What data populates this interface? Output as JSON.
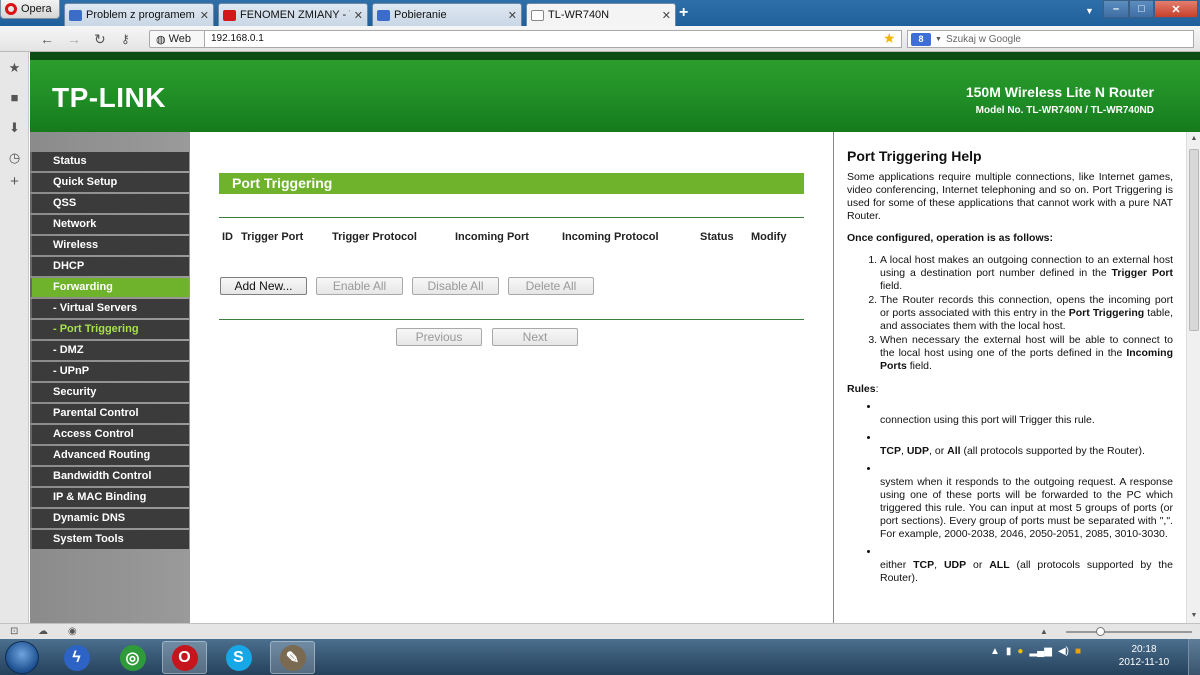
{
  "browser": {
    "menu_label": "Opera",
    "tabs": [
      {
        "title": "Problem z programem ...",
        "fav_color": "#3b6cc7"
      },
      {
        "title": "FENOMEN ZMIANY - Y...",
        "fav_color": "#d21818"
      },
      {
        "title": "Pobieranie",
        "fav_color": "#3b6cc7"
      },
      {
        "title": "TL-WR740N",
        "fav_color": "#888888"
      }
    ],
    "web_label": "Web",
    "url": "192.168.0.1",
    "search_placeholder": "Szukaj w Google",
    "window_min": "–",
    "window_max": "□",
    "window_close": "✕"
  },
  "router": {
    "brand": "TP-LINK",
    "product": "150M Wireless Lite N Router",
    "model": "Model No. TL-WR740N / TL-WR740ND",
    "accent_color": "#6fb22b",
    "menu": [
      {
        "label": "Status"
      },
      {
        "label": "Quick Setup"
      },
      {
        "label": "QSS"
      },
      {
        "label": "Network"
      },
      {
        "label": "Wireless"
      },
      {
        "label": "DHCP"
      },
      {
        "label": "Forwarding"
      },
      {
        "label": "- Virtual Servers"
      },
      {
        "label": "- Port Triggering"
      },
      {
        "label": "- DMZ"
      },
      {
        "label": "- UPnP"
      },
      {
        "label": "Security"
      },
      {
        "label": "Parental Control"
      },
      {
        "label": "Access Control"
      },
      {
        "label": "Advanced Routing"
      },
      {
        "label": "Bandwidth Control"
      },
      {
        "label": "IP & MAC Binding"
      },
      {
        "label": "Dynamic DNS"
      },
      {
        "label": "System Tools"
      }
    ],
    "section_title": "Port Triggering",
    "columns": [
      "ID",
      "Trigger Port",
      "Trigger Protocol",
      "Incoming Port",
      "Incoming Protocol",
      "Status",
      "Modify"
    ],
    "buttons": {
      "add_new": "Add New...",
      "enable_all": "Enable All",
      "disable_all": "Disable All",
      "delete_all": "Delete All",
      "previous": "Previous",
      "next": "Next"
    }
  },
  "help": {
    "title": "Port Triggering Help",
    "intro": "Some applications require multiple connections, like Internet games, video conferencing, Internet telephoning and so on. Port Triggering is used for some of these applications that cannot work with a pure NAT Router.",
    "configured_heading": "Once configured, operation is as follows:",
    "step1_a": "A local host makes an outgoing connection to an external host using a destination port number defined in the ",
    "step1_b": "Trigger Port",
    "step1_c": " field.",
    "step2_a": "The Router records this connection, opens the incoming port or ports associated with this entry in the ",
    "step2_b": "Port Triggering",
    "step2_c": " table, and associates them with the local host.",
    "step3_a": "When necessary the external host will be able to connect to the local host using one of the ports defined in the ",
    "step3_b": "Incoming Ports",
    "step3_c": " field.",
    "rules_heading": "Rules",
    "rules_colon": ":",
    "rule1": "connection using this port will Trigger this rule.",
    "rule2_a": "TCP",
    "rule2_b": ", ",
    "rule2_c": "UDP",
    "rule2_d": ", or ",
    "rule2_e": "All",
    "rule2_f": " (all protocols supported by the Router).",
    "rule3": "system when it responds to the outgoing request. A response using one of these ports will be forwarded to the PC which triggered this rule. You can input at most 5 groups of ports (or port sections). Every group of ports must be separated with \",\". For example, 2000-2038, 2046, 2050-2051, 2085, 3010-3030.",
    "rule4_a": "either ",
    "rule4_b": "TCP",
    "rule4_c": ", ",
    "rule4_d": "UDP",
    "rule4_e": " or ",
    "rule4_f": "ALL",
    "rule4_g": " (all protocols supported by the Router)."
  },
  "taskbar": {
    "time": "20:18",
    "date": "2012-11-10"
  }
}
